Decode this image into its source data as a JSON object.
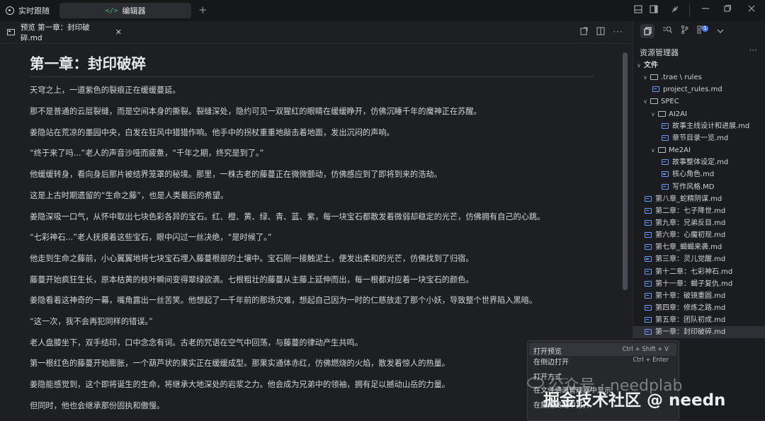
{
  "titlebar": {
    "follow_label": "实时跟随",
    "tab_label": "编辑器",
    "tab_icon": "</>",
    "plus": "+"
  },
  "editor_tab": {
    "label": "预览 第一章：封印破碎.md",
    "close": "✕"
  },
  "document": {
    "heading": "第一章：封印破碎",
    "paragraphs": [
      "天穹之上，一道紫色的裂痕正在缓缓蔓延。",
      "那不是普通的云层裂缝，而是空间本身的撕裂。裂缝深处，隐约可见一双猩红的眼睛在缓缓睁开，仿佛沉睡千年的魔神正在苏醒。",
      "姜隐站在荒凉的墨园中央，白发在狂风中猎猎作响。他手中的拐杖重重地敲击着地面，发出沉闷的声响。",
      "“终于来了吗...”老人的声音沙哑而疲惫，“千年之期，终究是到了。”",
      "他缓缓转身，看向身后那片被结界笼罩的秘境。那里，一株古老的藤蔓正在微微颤动，仿佛感应到了即将到来的浩劫。",
      "这是上古时期遗留的“生命之藤”，也是人类最后的希望。",
      "姜隐深吸一口气，从怀中取出七块色彩各异的宝石。红、橙、黄、绿、青、蓝、紫，每一块宝石都散发着微弱却稳定的光芒，仿佛拥有自己的心跳。",
      "“七彩神石...”老人抚摸着这些宝石，眼中闪过一丝决绝，“是时候了。”",
      "他走到生命之藤前，小心翼翼地将七块宝石埋入藤蔓根部的土壤中。宝石刚一接触泥土，便发出柔和的光芒，仿佛找到了归宿。",
      "藤蔓开始疯狂生长，原本枯黄的枝叶瞬间变得翠绿欲滴。七根粗壮的藤蔓从主藤上延伸而出，每一根都对应着一块宝石的颜色。",
      "姜隐看着这神奇的一幕，嘴角露出一丝苦笑。他想起了一千年前的那场灾难，想起自己因为一时的仁慈放走了那个小妖，导致整个世界陷入黑暗。",
      "“这一次，我不会再犯同样的错误。”",
      "老人盘膝坐下，双手结印，口中念念有词。古老的咒语在空气中回荡，与藤蔓的律动产生共鸣。",
      "第一根红色的藤蔓开始膨胀，一个葫芦状的果实正在缓缓成型。那果实通体赤红，仿佛燃烧的火焰，散发着惊人的热量。",
      "姜隐能感觉到，这个即将诞生的生命，将继承大地深处的岩浆之力。他会成为兄弟中的领袖，拥有足以撼动山岳的力量。",
      "但同时，他也会继承那份固执和傲慢。"
    ]
  },
  "sidebar": {
    "title": "资源管理器",
    "more": "···",
    "tree": [
      {
        "label": "文件",
        "kind": "section",
        "depth": 0,
        "chev": "∨"
      },
      {
        "label": ".trae \\ rules",
        "kind": "folder",
        "depth": 1,
        "chev": "∨"
      },
      {
        "label": "project_rules.md",
        "kind": "file",
        "depth": 2
      },
      {
        "label": "SPEC",
        "kind": "folder",
        "depth": 1,
        "chev": "∨"
      },
      {
        "label": "AI2AI",
        "kind": "folder",
        "depth": 2,
        "chev": "∨"
      },
      {
        "label": "故事主线设计和进展.md",
        "kind": "file",
        "depth": 3
      },
      {
        "label": "章节目录一览.md",
        "kind": "file",
        "depth": 3
      },
      {
        "label": "Me2AI",
        "kind": "folder",
        "depth": 2,
        "chev": "∨"
      },
      {
        "label": "故事整体设定.md",
        "kind": "file",
        "depth": 3
      },
      {
        "label": "核心角色.md",
        "kind": "file",
        "depth": 3
      },
      {
        "label": "写作风格.MD",
        "kind": "file",
        "depth": 3
      },
      {
        "label": "第八章_蛇精阴谋.md",
        "kind": "file",
        "depth": 1
      },
      {
        "label": "第二章：七子降世.md",
        "kind": "file",
        "depth": 1
      },
      {
        "label": "第九章：兄弟反目.md",
        "kind": "file",
        "depth": 1
      },
      {
        "label": "第六章：心魔初现.md",
        "kind": "file",
        "depth": 1
      },
      {
        "label": "第七章_蝎蝎来袭.md",
        "kind": "file",
        "depth": 1
      },
      {
        "label": "第三章：灵儿觉醒.md",
        "kind": "file",
        "depth": 1
      },
      {
        "label": "第十二章：七彩神石.md",
        "kind": "file",
        "depth": 1
      },
      {
        "label": "第十一章：蝎子复仇.md",
        "kind": "file",
        "depth": 1
      },
      {
        "label": "第十章：破镜重圆.md",
        "kind": "file",
        "depth": 1
      },
      {
        "label": "第四章：修炼之路.md",
        "kind": "file",
        "depth": 1
      },
      {
        "label": "第五章：团队初成.md",
        "kind": "file",
        "depth": 1
      },
      {
        "label": "第一章：封印破碎.md",
        "kind": "file",
        "depth": 1,
        "selected": true
      }
    ]
  },
  "context_menu": [
    {
      "label": "打开预览",
      "shortcut": "Ctrl + Shift + V",
      "highlighted": true
    },
    {
      "label": "在侧边打开",
      "shortcut": "Ctrl + Enter"
    },
    {
      "label": "打开方式...",
      "shortcut": ""
    },
    {
      "label": "在文件资源管理器中显示",
      "shortcut": ""
    },
    {
      "label": "在集成终端中打开",
      "shortcut": ""
    }
  ],
  "watermark": {
    "line1": "公众号 · needplab",
    "line2": "掘金技术社区 @ needn"
  }
}
